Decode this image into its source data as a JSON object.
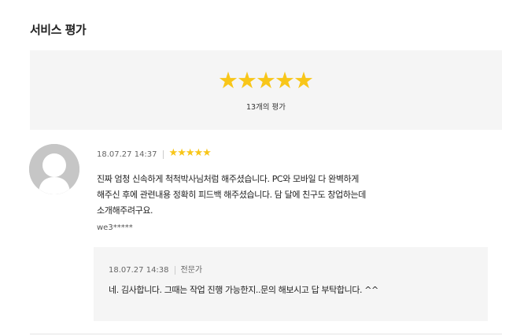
{
  "section": {
    "title": "서비스 평가"
  },
  "summary": {
    "rating_stars": 5,
    "max_stars": 5,
    "count_text": "13개의 평가",
    "star_icon": "star-icon",
    "star_color": "#f8c619"
  },
  "review": {
    "date": "18.07.27 14:37",
    "rating_stars": 5,
    "lines": [
      "진짜 엄청 신속하게 척척박사님처럼 해주셨습니다. PC와 모바일 다 완벽하게",
      "해주신 후에 관련내용 정확히 피드백 해주셨습니다. 담 달에 친구도 창업하는데",
      "소개해주려구요."
    ],
    "author": "we3*****",
    "avatar_icon": "default-user-avatar-icon"
  },
  "reply": {
    "date": "18.07.27 14:38",
    "role": "전문가",
    "text": "네. 김사합니다. 그때는 작업 진행 가능한지..문의 해보시고 답 부탁합니다. ^^"
  }
}
